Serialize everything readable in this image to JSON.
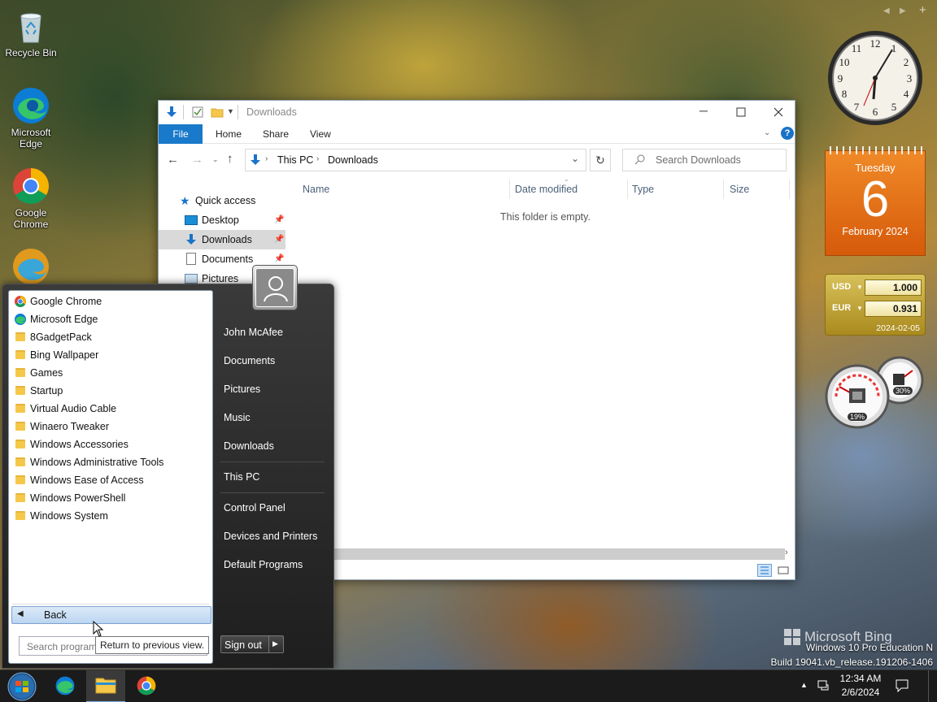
{
  "desktop": {
    "icons": [
      {
        "label": "Recycle Bin"
      },
      {
        "label": "Microsoft Edge"
      },
      {
        "label": "Google Chrome"
      }
    ],
    "watermark": {
      "brand": "Microsoft Bing",
      "edition": "Windows 10 Pro Education N",
      "build": "Build 19041.vb_release.191206-1406"
    }
  },
  "explorer": {
    "title": "Downloads",
    "ribbon_tabs": [
      "File",
      "Home",
      "Share",
      "View"
    ],
    "address": {
      "crumbs": [
        "This PC",
        "Downloads"
      ]
    },
    "search_placeholder": "Search Downloads",
    "nav": {
      "quick_access": "Quick access",
      "items": [
        {
          "label": "Desktop",
          "pinned": true
        },
        {
          "label": "Downloads",
          "pinned": true,
          "selected": true
        },
        {
          "label": "Documents",
          "pinned": true
        },
        {
          "label": "Pictures",
          "pinned": false
        }
      ]
    },
    "columns": [
      "Name",
      "Date modified",
      "Type",
      "Size"
    ],
    "empty_message": "This folder is empty.",
    "accent": "#0063b1"
  },
  "start_menu": {
    "programs": [
      {
        "label": "Google Chrome",
        "icon": "chrome-icon"
      },
      {
        "label": "Microsoft Edge",
        "icon": "edge-icon"
      },
      {
        "label": "8GadgetPack",
        "icon": "folder-icon"
      },
      {
        "label": "Bing Wallpaper",
        "icon": "folder-icon"
      },
      {
        "label": "Games",
        "icon": "folder-icon"
      },
      {
        "label": "Startup",
        "icon": "folder-icon"
      },
      {
        "label": "Virtual Audio Cable",
        "icon": "folder-icon"
      },
      {
        "label": "Winaero Tweaker",
        "icon": "folder-icon"
      },
      {
        "label": "Windows Accessories",
        "icon": "folder-icon"
      },
      {
        "label": "Windows Administrative Tools",
        "icon": "folder-icon"
      },
      {
        "label": "Windows Ease of Access",
        "icon": "folder-icon"
      },
      {
        "label": "Windows PowerShell",
        "icon": "folder-icon"
      },
      {
        "label": "Windows System",
        "icon": "folder-icon"
      }
    ],
    "back_label": "Back",
    "search_placeholder": "Search programs and files",
    "tooltip": "Return to previous view.",
    "user": "John McAfee",
    "links_group1": [
      "Documents",
      "Pictures",
      "Music",
      "Downloads"
    ],
    "links_group2": [
      "This PC"
    ],
    "links_group3": [
      "Control Panel",
      "Devices and Printers",
      "Default Programs"
    ],
    "signout_label": "Sign out"
  },
  "gadgets": {
    "calendar": {
      "weekday": "Tuesday",
      "day": "6",
      "month_year": "February 2024"
    },
    "currency": {
      "rows": [
        {
          "code": "USD",
          "value": "1.000"
        },
        {
          "code": "EUR",
          "value": "0.931"
        }
      ],
      "date": "2024-02-05"
    },
    "meters": {
      "cpu": "19%",
      "memory": "30%"
    }
  },
  "taskbar": {
    "time": "12:34 AM",
    "date": "2/6/2024"
  }
}
